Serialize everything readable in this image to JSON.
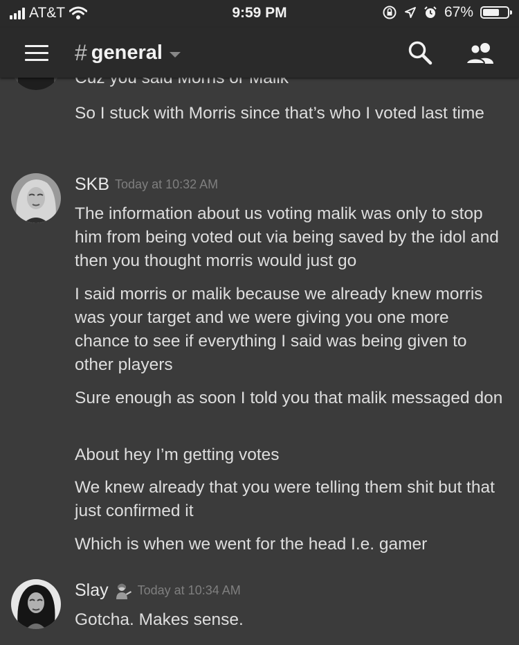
{
  "status_bar": {
    "carrier": "AT&T",
    "time": "9:59 PM",
    "battery": "67%",
    "battery_level": 0.67,
    "icons": [
      "signal-icon",
      "wifi-icon",
      "rotation-lock-icon",
      "location-icon",
      "alarm-icon",
      "battery-icon"
    ]
  },
  "header": {
    "hash": "#",
    "channel": "general",
    "icons": [
      "menu-icon",
      "chevron-down-icon",
      "search-icon",
      "members-icon"
    ]
  },
  "messages": {
    "partial_line": "Cuz you said Morris or Malik",
    "prev_group": [
      "So I stuck with Morris since that’s who I voted last time"
    ],
    "skb": {
      "author": "SKB",
      "timestamp": "Today at 10:32 AM",
      "lines": [
        "The information about us voting malik was only to stop him from being voted out via being saved by the idol and then you thought morris would just go",
        "I said morris or malik because we already knew morris was your target and we were giving you one more chance to see if everything I said was being given to other players",
        "Sure enough as soon I told you that malik messaged don",
        "About hey I’m getting votes",
        "We knew already that you were telling them shit but that just confirmed it",
        "Which is when we went for the head I.e. gamer"
      ]
    },
    "slay": {
      "author": "Slay",
      "emoji": "person-tipping-hand-emoji",
      "timestamp": "Today at 10:34 AM",
      "lines": [
        "Gotcha. Makes sense."
      ]
    }
  }
}
